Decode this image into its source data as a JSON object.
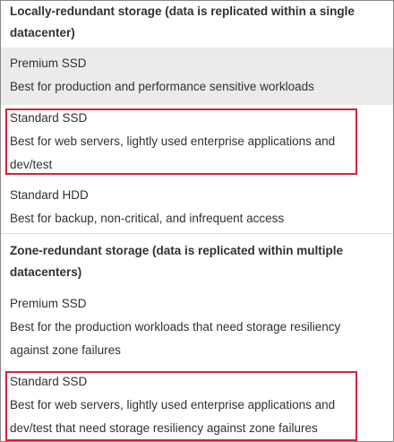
{
  "sections": [
    {
      "header": "Locally-redundant storage (data is replicated within a single datacenter)",
      "options": [
        {
          "title": "Premium SSD",
          "description": "Best for production and performance sensitive workloads",
          "selected": true,
          "highlighted": false
        },
        {
          "title": "Standard SSD",
          "description": "Best for web servers, lightly used enterprise applications and dev/test",
          "selected": false,
          "highlighted": true
        },
        {
          "title": "Standard HDD",
          "description": "Best for backup, non-critical, and infrequent access",
          "selected": false,
          "highlighted": false
        }
      ]
    },
    {
      "header": "Zone-redundant storage (data is replicated within multiple datacenters)",
      "options": [
        {
          "title": "Premium SSD",
          "description": "Best for the production workloads that need storage resiliency against zone failures",
          "selected": false,
          "highlighted": false
        },
        {
          "title": "Standard SSD",
          "description": "Best for web servers, lightly used enterprise applications and dev/test that need storage resiliency against zone failures",
          "selected": false,
          "highlighted": true
        }
      ]
    }
  ],
  "colors": {
    "selected_background": "#ecebea",
    "highlight_border": "#d2233c",
    "text": "#323130"
  }
}
